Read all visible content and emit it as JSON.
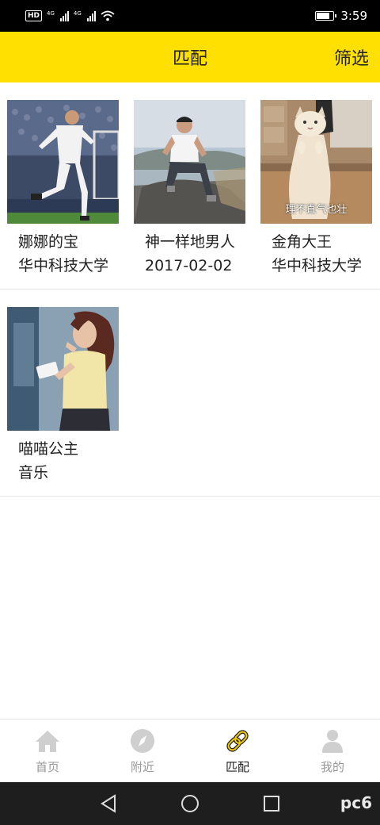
{
  "status_bar": {
    "badge": "HD",
    "net1": "4G",
    "net2": "4G",
    "time": "3:59"
  },
  "header": {
    "title": "匹配",
    "filter_label": "筛选"
  },
  "cards": [
    {
      "name": "娜娜的宝",
      "sub": "华中科技大学",
      "photo_icon": "soccer-player-photo"
    },
    {
      "name": "神一样地男人",
      "sub": "2017-02-02",
      "photo_icon": "man-on-rock-photo"
    },
    {
      "name": "金角大王",
      "sub": "华中科技大学",
      "photo_icon": "standing-cat-photo",
      "caption": "理不直气也壮"
    },
    {
      "name": "喵喵公主",
      "sub": "音乐",
      "photo_icon": "woman-with-phone-photo"
    }
  ],
  "bottom_nav": [
    {
      "label": "首页",
      "icon": "home-icon",
      "active": false
    },
    {
      "label": "附近",
      "icon": "compass-icon",
      "active": false
    },
    {
      "label": "匹配",
      "icon": "link-icon",
      "active": true
    },
    {
      "label": "我的",
      "icon": "user-icon",
      "active": false
    }
  ],
  "system_nav": [
    "back-icon",
    "home-circle-icon",
    "recents-icon"
  ],
  "watermark": "pc6",
  "colors": {
    "header_bg": "#ffe000",
    "active_icon": "#f2cc00",
    "inactive": "#999999"
  }
}
